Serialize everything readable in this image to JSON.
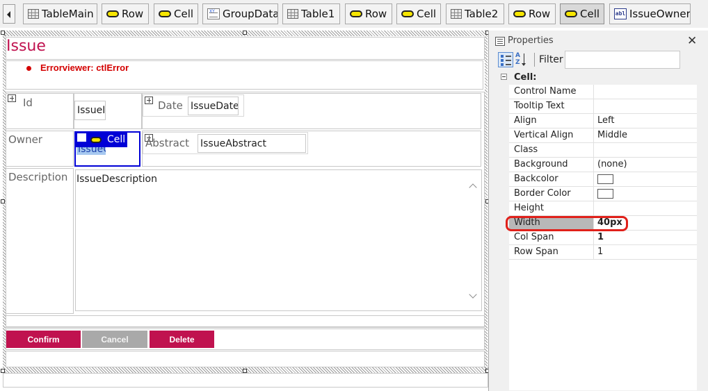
{
  "breadcrumb": [
    {
      "label": "TableMain",
      "icon": "table-icon"
    },
    {
      "label": "Row",
      "icon": "row-pill-icon"
    },
    {
      "label": "Cell",
      "icon": "cell-pill-icon"
    },
    {
      "label": "GroupData",
      "icon": "group-data-icon"
    },
    {
      "label": "Table1",
      "icon": "table-icon"
    },
    {
      "label": "Row",
      "icon": "row-pill-icon"
    },
    {
      "label": "Cell",
      "icon": "cell-pill-icon"
    },
    {
      "label": "Table2",
      "icon": "table-icon"
    },
    {
      "label": "Row",
      "icon": "row-pill-icon"
    },
    {
      "label": "Cell",
      "icon": "cell-pill-icon",
      "active": true
    },
    {
      "label": "IssueOwner",
      "icon": "label-control-icon"
    }
  ],
  "form": {
    "title": "Issue",
    "error_viewer": "Errorviewer: ctlError",
    "id_label": "Id",
    "id_field": "IssueId",
    "date_label": "Date",
    "date_field": "IssueDate",
    "owner_label": "Owner",
    "owner_field": "IssueOwner",
    "selected_tag": "Cell",
    "abstract_label": "Abstract",
    "abstract_field": "IssueAbstract",
    "description_label": "Description",
    "description_field": "IssueDescription",
    "buttons": {
      "confirm": "Confirm",
      "cancel": "Cancel",
      "delete": "Delete"
    }
  },
  "properties": {
    "title": "Properties",
    "filter_label": "Filter",
    "category": "Cell:",
    "rows": [
      {
        "name": "Control Name",
        "value": ""
      },
      {
        "name": "Tooltip Text",
        "value": ""
      },
      {
        "name": "Align",
        "value": "Left"
      },
      {
        "name": "Vertical Align",
        "value": "Middle"
      },
      {
        "name": "Class",
        "value": ""
      },
      {
        "name": "Background",
        "value": "(none)"
      },
      {
        "name": "Backcolor",
        "value": "",
        "swatch": "#ffffff"
      },
      {
        "name": "Border Color",
        "value": "",
        "swatch": "#ffffff"
      },
      {
        "name": "Height",
        "value": ""
      },
      {
        "name": "Width",
        "value": "40px",
        "highlighted": true,
        "bold": true
      },
      {
        "name": "Col Span",
        "value": "1",
        "bold": true
      },
      {
        "name": "Row Span",
        "value": "1"
      }
    ]
  },
  "colors": {
    "brand": "#c0124f",
    "selection": "#0000d6",
    "error": "#d40000",
    "highlight_ring": "#e0201a"
  }
}
